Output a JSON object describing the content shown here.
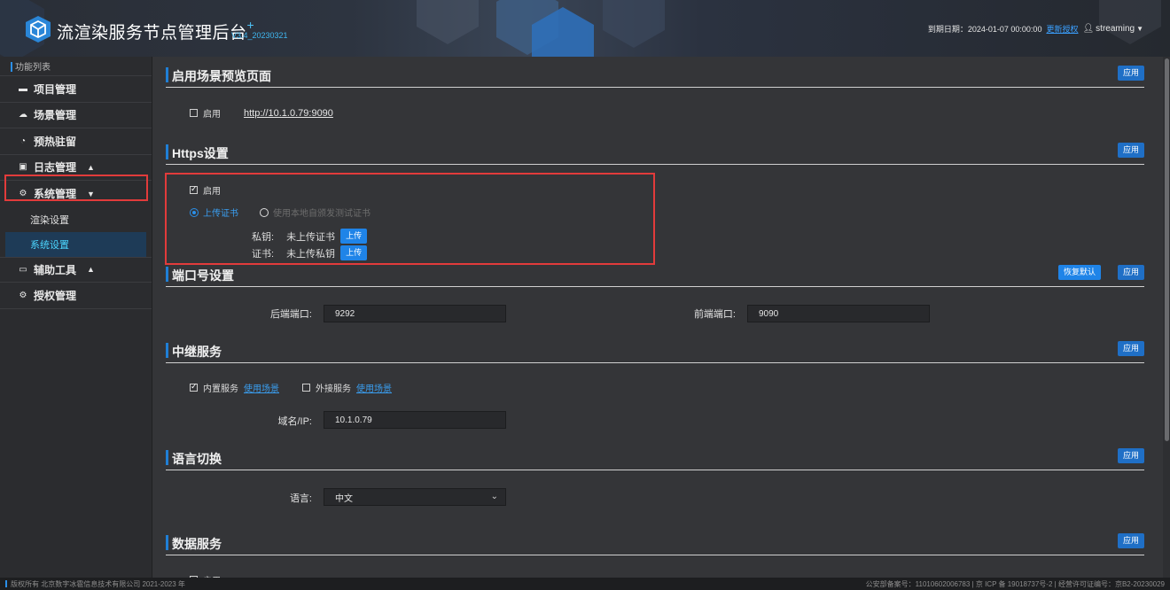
{
  "header": {
    "title": "流渲染服务节点管理后台",
    "version": "V3.4_20230321",
    "expire_label": "到期日期：2024-01-07 00:00:00",
    "update_license": "更新授权",
    "username": "streaming"
  },
  "sidebar": {
    "caption": "功能列表",
    "items": [
      {
        "label": "项目管理",
        "icon": "folder-icon"
      },
      {
        "label": "场景管理",
        "icon": "cloud-icon"
      },
      {
        "label": "预热驻留",
        "icon": "clock-icon"
      },
      {
        "label": "日志管理",
        "icon": "log-icon"
      },
      {
        "label": "系统管理",
        "icon": "gear-icon"
      },
      {
        "label": "辅助工具",
        "icon": "tool-icon"
      },
      {
        "label": "授权管理",
        "icon": "license-icon"
      }
    ],
    "sub_items": [
      "渲染设置",
      "系统设置"
    ]
  },
  "sections": {
    "preview": {
      "title": "启用场景预览页面",
      "apply": "应用",
      "enable": "启用",
      "url": "http://10.1.0.79:9090"
    },
    "https": {
      "title": "Https设置",
      "apply": "应用",
      "enable": "启用",
      "upload_cert": "上传证书",
      "self_signed": "使用本地自颁发测试证书",
      "private_key_label": "私钥:",
      "private_key_value": "未上传证书",
      "cert_label": "证书:",
      "cert_value": "未上传私钥",
      "upload": "上传"
    },
    "ports": {
      "title": "端口号设置",
      "reset": "恢复默认",
      "apply": "应用",
      "backend_label": "后端端口:",
      "backend_value": "9292",
      "frontend_label": "前端端口:",
      "frontend_value": "9090"
    },
    "relay": {
      "title": "中继服务",
      "apply": "应用",
      "internal": "内置服务",
      "internal_link": "使用场景",
      "external": "外接服务",
      "external_link": "使用场景",
      "domain_label": "域名/IP:",
      "domain_value": "10.1.0.79"
    },
    "language": {
      "title": "语言切换",
      "apply": "应用",
      "label": "语言:",
      "value": "中文"
    },
    "data": {
      "title": "数据服务",
      "apply": "应用",
      "enable": "启用"
    }
  },
  "footer": {
    "left": "版权所有 北京数字冰雹信息技术有限公司 2021-2023 年",
    "right": "公安部备案号：11010602006783 | 京 ICP 备 19018737号-2 | 经营许可证编号：京B2-20230029"
  },
  "colors": {
    "accent": "#1f6fc6",
    "highlight_border": "#e23b3b",
    "active_text": "#4cd6ff"
  }
}
